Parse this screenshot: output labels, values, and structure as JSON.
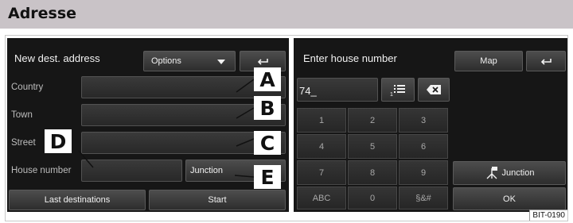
{
  "section_title": "Adresse",
  "figure_id": "BIT-0190",
  "left_screen": {
    "title": "New dest. address",
    "options_label": "Options",
    "country_label": "Country",
    "town_label": "Town",
    "street_label": "Street",
    "house_number_label": "House number",
    "junction_label": "Junction",
    "last_destinations_label": "Last destinations",
    "start_label": "Start"
  },
  "right_screen": {
    "title": "Enter house number",
    "map_label": "Map",
    "input_value": "74_",
    "list_icon_index": "1",
    "keys": [
      "1",
      "2",
      "3",
      "4",
      "5",
      "6",
      "7",
      "8",
      "9",
      "ABC",
      "0",
      "§&#"
    ],
    "junction_label": "Junction",
    "ok_label": "OK"
  },
  "callouts": [
    "A",
    "B",
    "C",
    "D",
    "E"
  ],
  "icons": [
    "chevron-down-icon",
    "return-arrow-icon",
    "list-icon",
    "backspace-icon",
    "junction-flag-icon"
  ]
}
